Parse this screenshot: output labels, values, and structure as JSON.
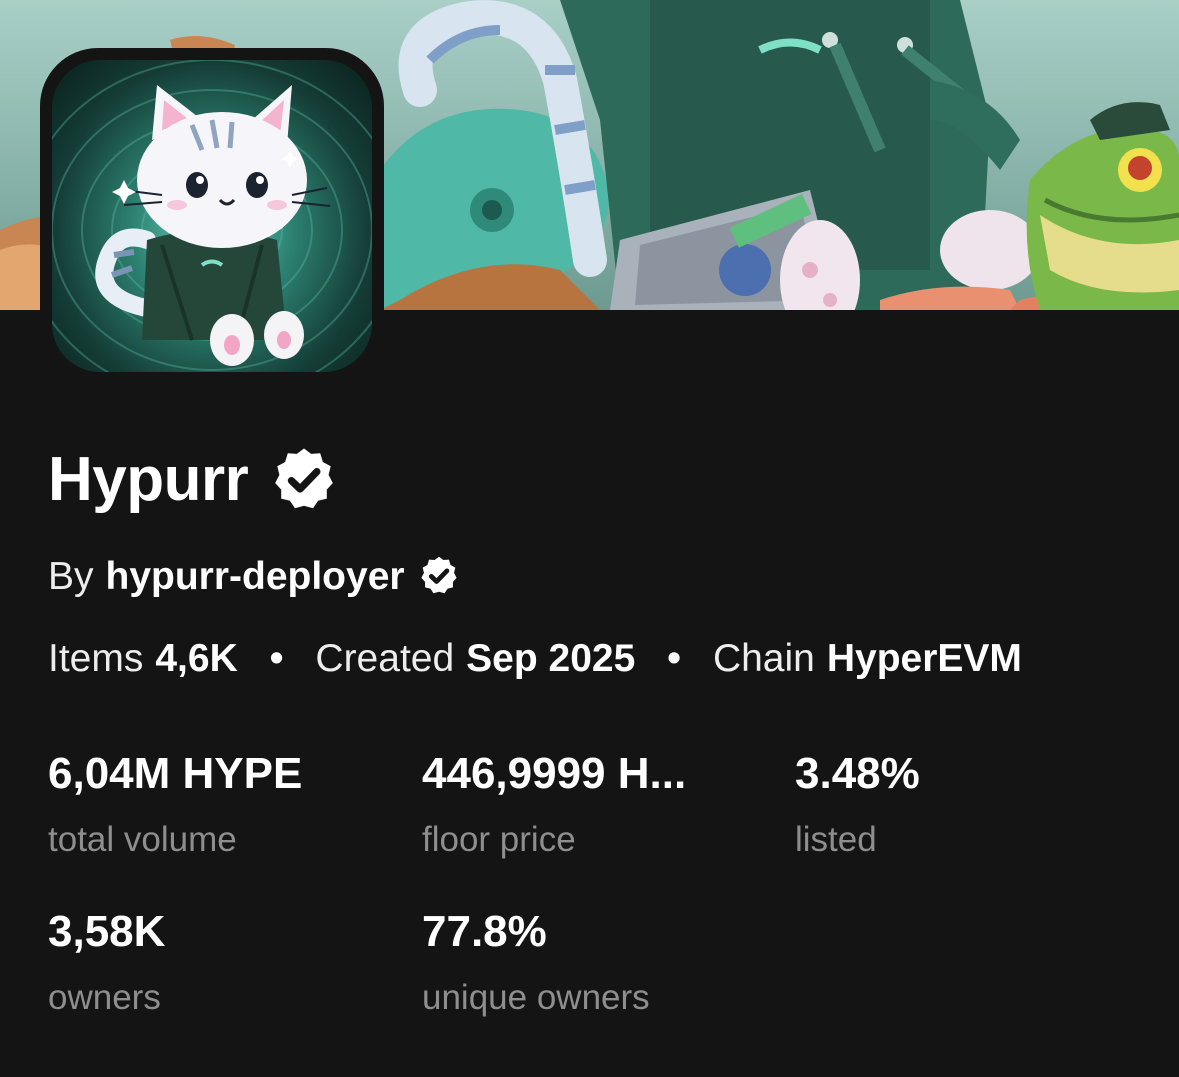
{
  "collection": {
    "name": "Hypurr",
    "creator_prefix": "By",
    "creator_name": "hypurr-deployer"
  },
  "meta": {
    "items_label": "Items",
    "items_value": "4,6K",
    "created_label": "Created",
    "created_value": "Sep 2025",
    "chain_label": "Chain",
    "chain_value": "HyperEVM",
    "separator": "•"
  },
  "stats": {
    "total_volume": {
      "value": "6,04M HYPE",
      "label": "total volume"
    },
    "floor_price": {
      "value": "446,9999 H...",
      "label": "floor price"
    },
    "listed": {
      "value": "3.48%",
      "label": "listed"
    },
    "owners": {
      "value": "3,58K",
      "label": "owners"
    },
    "unique_owners": {
      "value": "77.8%",
      "label": "unique owners"
    }
  },
  "icons": {
    "verified": "verified-badge-icon"
  },
  "colors": {
    "background": "#141414",
    "text": "#ffffff",
    "muted": "#8e8e8e"
  }
}
